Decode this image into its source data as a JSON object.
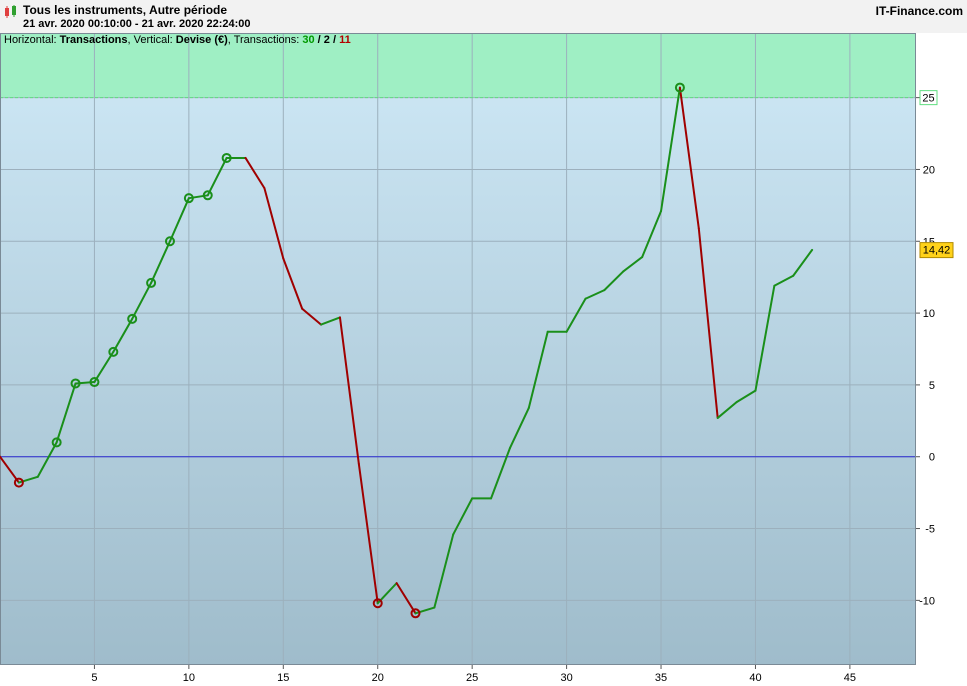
{
  "header": {
    "title": "Tous les instruments, Autre période",
    "date_range": "21 avr. 2020 00:10:00 - 21 avr. 2020 22:24:00",
    "brand": "IT-Finance.com"
  },
  "info": {
    "horizontal_label": "Horizontal: ",
    "horizontal_value": "Transactions",
    "vertical_label": ", Vertical: ",
    "vertical_value": "Devise (€)",
    "transactions_label": ", Transactions: ",
    "wins": "30",
    "sep1": " / ",
    "neutral": "2",
    "sep2": " / ",
    "losses": "11"
  },
  "colors": {
    "up": "#1a8f1a",
    "down": "#a00000",
    "zero_line": "#2a2ad0",
    "target_zone": "#9fefc4",
    "target_line": "#5fdf7f",
    "bg_top": "#cfe9f7",
    "bg_bottom": "#9fbccb",
    "last_value_bg": "#ffd21a"
  },
  "chart_data": {
    "type": "line",
    "xlabel": "",
    "ylabel": "",
    "xlim": [
      0,
      48.5
    ],
    "ylim": [
      -14.5,
      29.5
    ],
    "x_ticks": [
      "5",
      "10",
      "15",
      "20",
      "25",
      "30",
      "35",
      "40",
      "45"
    ],
    "y_ticks": [
      "25",
      "20",
      "15",
      "10",
      "5",
      "0",
      "-5",
      "-10"
    ],
    "target_value": 25,
    "last_value_label": "14,42",
    "last_value": 14.42,
    "zero_line": 0,
    "x": [
      0,
      1,
      2,
      3,
      4,
      5,
      6,
      7,
      8,
      9,
      10,
      11,
      12,
      13,
      14,
      15,
      16,
      17,
      18,
      19,
      20,
      21,
      22,
      23,
      24,
      25,
      26,
      27,
      28,
      29,
      30,
      31,
      32,
      33,
      34,
      35,
      36,
      37,
      38,
      39,
      40,
      41,
      42,
      43
    ],
    "values": [
      0,
      -1.8,
      -1.4,
      1.0,
      5.1,
      5.2,
      7.3,
      9.6,
      12.1,
      15.0,
      18.0,
      18.2,
      20.8,
      20.8,
      18.7,
      13.8,
      10.3,
      9.2,
      9.7,
      -0.5,
      -10.2,
      -8.8,
      -10.9,
      -10.5,
      -5.4,
      -2.9,
      -2.9,
      0.6,
      3.4,
      8.7,
      8.7,
      11.0,
      11.6,
      12.9,
      13.9,
      17.1,
      25.7,
      15.9,
      2.7,
      3.8,
      4.6,
      11.9,
      12.6,
      14.4
    ],
    "markers": [
      {
        "x": 1,
        "y": -1.8,
        "type": "loss"
      },
      {
        "x": 3,
        "y": 1.0,
        "type": "win"
      },
      {
        "x": 4,
        "y": 5.1,
        "type": "win"
      },
      {
        "x": 5,
        "y": 5.2,
        "type": "win"
      },
      {
        "x": 6,
        "y": 7.3,
        "type": "win"
      },
      {
        "x": 7,
        "y": 9.6,
        "type": "win"
      },
      {
        "x": 8,
        "y": 12.1,
        "type": "win"
      },
      {
        "x": 9,
        "y": 15.0,
        "type": "win"
      },
      {
        "x": 10,
        "y": 18.0,
        "type": "win"
      },
      {
        "x": 11,
        "y": 18.2,
        "type": "win"
      },
      {
        "x": 12,
        "y": 20.8,
        "type": "win"
      },
      {
        "x": 20,
        "y": -10.2,
        "type": "loss"
      },
      {
        "x": 22,
        "y": -10.9,
        "type": "loss"
      },
      {
        "x": 36,
        "y": 25.7,
        "type": "win"
      }
    ]
  }
}
